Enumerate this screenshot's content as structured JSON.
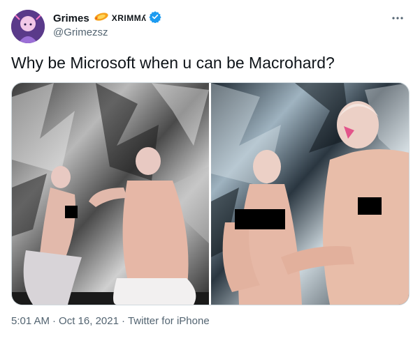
{
  "author": {
    "display_name": "Grimes",
    "name_glyphs": "XRIMMʎ",
    "handle": "@Grimezsz",
    "verified": true,
    "avatar_icon": "avatar-image",
    "name_emoji_icon": "flame-icon",
    "verified_icon": "verified-badge-icon"
  },
  "more_icon": "more-options-icon",
  "tweet": {
    "text": "Why be Microsoft when u can be Macrohard?"
  },
  "media": {
    "photo_count": 2
  },
  "meta": {
    "time": "5:01 AM",
    "separator": "·",
    "date": "Oct 16, 2021",
    "source": "Twitter for iPhone"
  },
  "colors": {
    "text_primary": "#0f1419",
    "text_secondary": "#536471",
    "verified_blue": "#1d9bf0",
    "border": "#cfd9de"
  }
}
